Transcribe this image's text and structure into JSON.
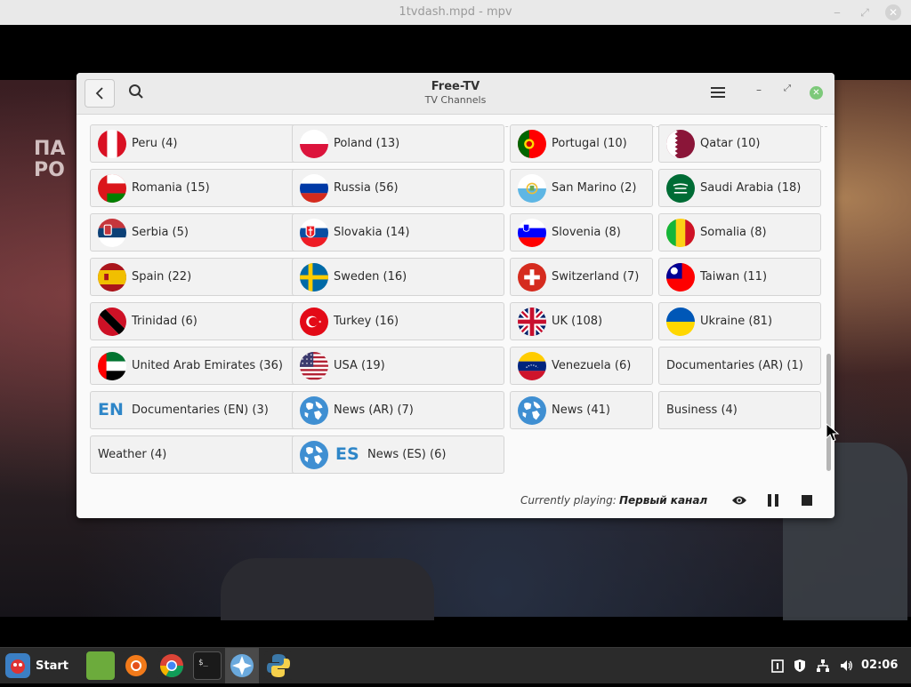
{
  "mpv": {
    "window_title": "1tvdash.mpd - mpv",
    "minimize": "‒",
    "maximize": "⤢",
    "close": "✕",
    "overlay_text_line1": "ПА",
    "overlay_text_line2": "РО"
  },
  "app": {
    "title": "Free-TV",
    "subtitle": "TV Channels",
    "minimize": "–",
    "maximize": "⤢",
    "close": "✕"
  },
  "channels": [
    {
      "label": "Peru (4)",
      "flag": "peru"
    },
    {
      "label": "Poland (13)",
      "flag": "poland"
    },
    {
      "label": "Portugal (10)",
      "flag": "portugal"
    },
    {
      "label": "Qatar (10)",
      "flag": "qatar"
    },
    {
      "label": "Romania (15)",
      "flag": "oman"
    },
    {
      "label": "Russia (56)",
      "flag": "russia"
    },
    {
      "label": "San Marino (2)",
      "flag": "san-marino"
    },
    {
      "label": "Saudi Arabia (18)",
      "flag": "saudi-arabia"
    },
    {
      "label": "Serbia (5)",
      "flag": "serbia"
    },
    {
      "label": "Slovakia (14)",
      "flag": "slovakia"
    },
    {
      "label": "Slovenia (8)",
      "flag": "slovenia"
    },
    {
      "label": "Somalia (8)",
      "flag": "mali"
    },
    {
      "label": "Spain (22)",
      "flag": "spain"
    },
    {
      "label": "Sweden (16)",
      "flag": "sweden"
    },
    {
      "label": "Switzerland (7)",
      "flag": "switzerland"
    },
    {
      "label": "Taiwan (11)",
      "flag": "taiwan"
    },
    {
      "label": "Trinidad (6)",
      "flag": "trinidad"
    },
    {
      "label": "Turkey (16)",
      "flag": "turkey"
    },
    {
      "label": "UK (108)",
      "flag": "uk"
    },
    {
      "label": "Ukraine (81)",
      "flag": "ukraine"
    },
    {
      "label": "United Arab Emirates (36)",
      "flag": "uae"
    },
    {
      "label": "USA (19)",
      "flag": "usa"
    },
    {
      "label": "Venezuela (6)",
      "flag": "venezuela"
    },
    {
      "label": "Documentaries (AR) (1)",
      "flag": "none"
    },
    {
      "label": "Documentaries (EN) (3)",
      "flag": "none",
      "code": "EN"
    },
    {
      "label": "News (AR) (7)",
      "flag": "globe"
    },
    {
      "label": "News (41)",
      "flag": "globe"
    },
    {
      "label": "Business (4)",
      "flag": "none"
    },
    {
      "label": "Weather (4)",
      "flag": "none"
    },
    {
      "label": "News (ES) (6)",
      "flag": "globe",
      "code": "ES"
    }
  ],
  "footer": {
    "playing_label": "Currently playing:",
    "playing_value": "Первый канал"
  },
  "taskbar": {
    "start_label": "Start",
    "clock": "02:06",
    "apps": [
      "file-manager-icon",
      "firefox-icon",
      "chrome-icon",
      "terminal-icon",
      "mpv-icon",
      "python-icon"
    ]
  },
  "colors": {
    "accent_blue": "#2e86c8",
    "close_green": "#7dc97a"
  }
}
